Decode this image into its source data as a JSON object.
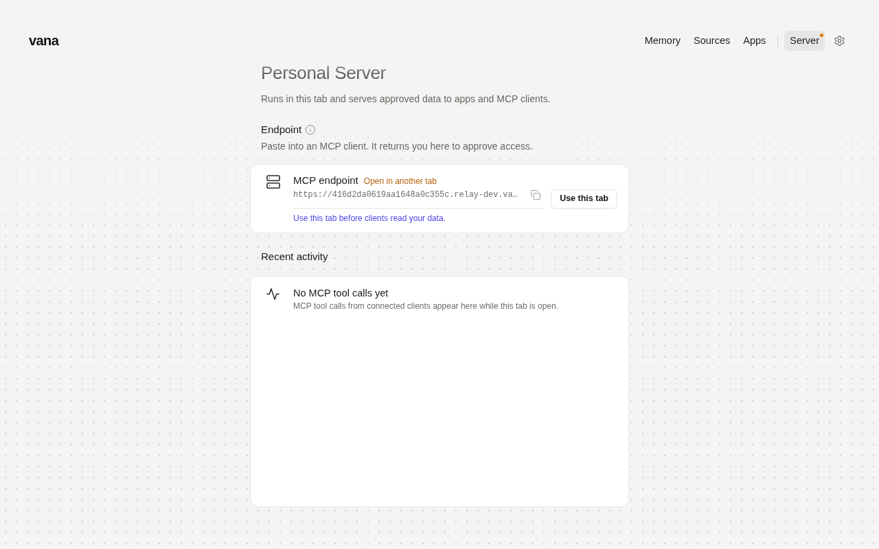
{
  "header": {
    "logo": "vana",
    "nav": {
      "primary": [
        {
          "label": "Memory",
          "selected": false,
          "notification": false
        },
        {
          "label": "Sources",
          "selected": false,
          "notification": false
        },
        {
          "label": "Apps",
          "selected": false,
          "notification": false
        }
      ],
      "secondary": [
        {
          "label": "Server",
          "selected": true,
          "notification": true
        }
      ]
    }
  },
  "page": {
    "title": "Personal Server",
    "subtitle": "Runs in this tab and serves approved data to apps and MCP clients."
  },
  "endpoint_section": {
    "heading": "Endpoint",
    "description": "Paste into an MCP client. It returns you here to approve access.",
    "card": {
      "title": "MCP endpoint",
      "status": "Open in another tab",
      "url": "https://416d2da0619aa1648a0c355c.relay-dev.va…",
      "hint": "Use this tab before clients read your data.",
      "button": "Use this tab"
    }
  },
  "activity_section": {
    "heading": "Recent activity",
    "empty_state": {
      "title": "No MCP tool calls yet",
      "description": "MCP tool calls from connected clients appear here while this tab is open."
    }
  }
}
